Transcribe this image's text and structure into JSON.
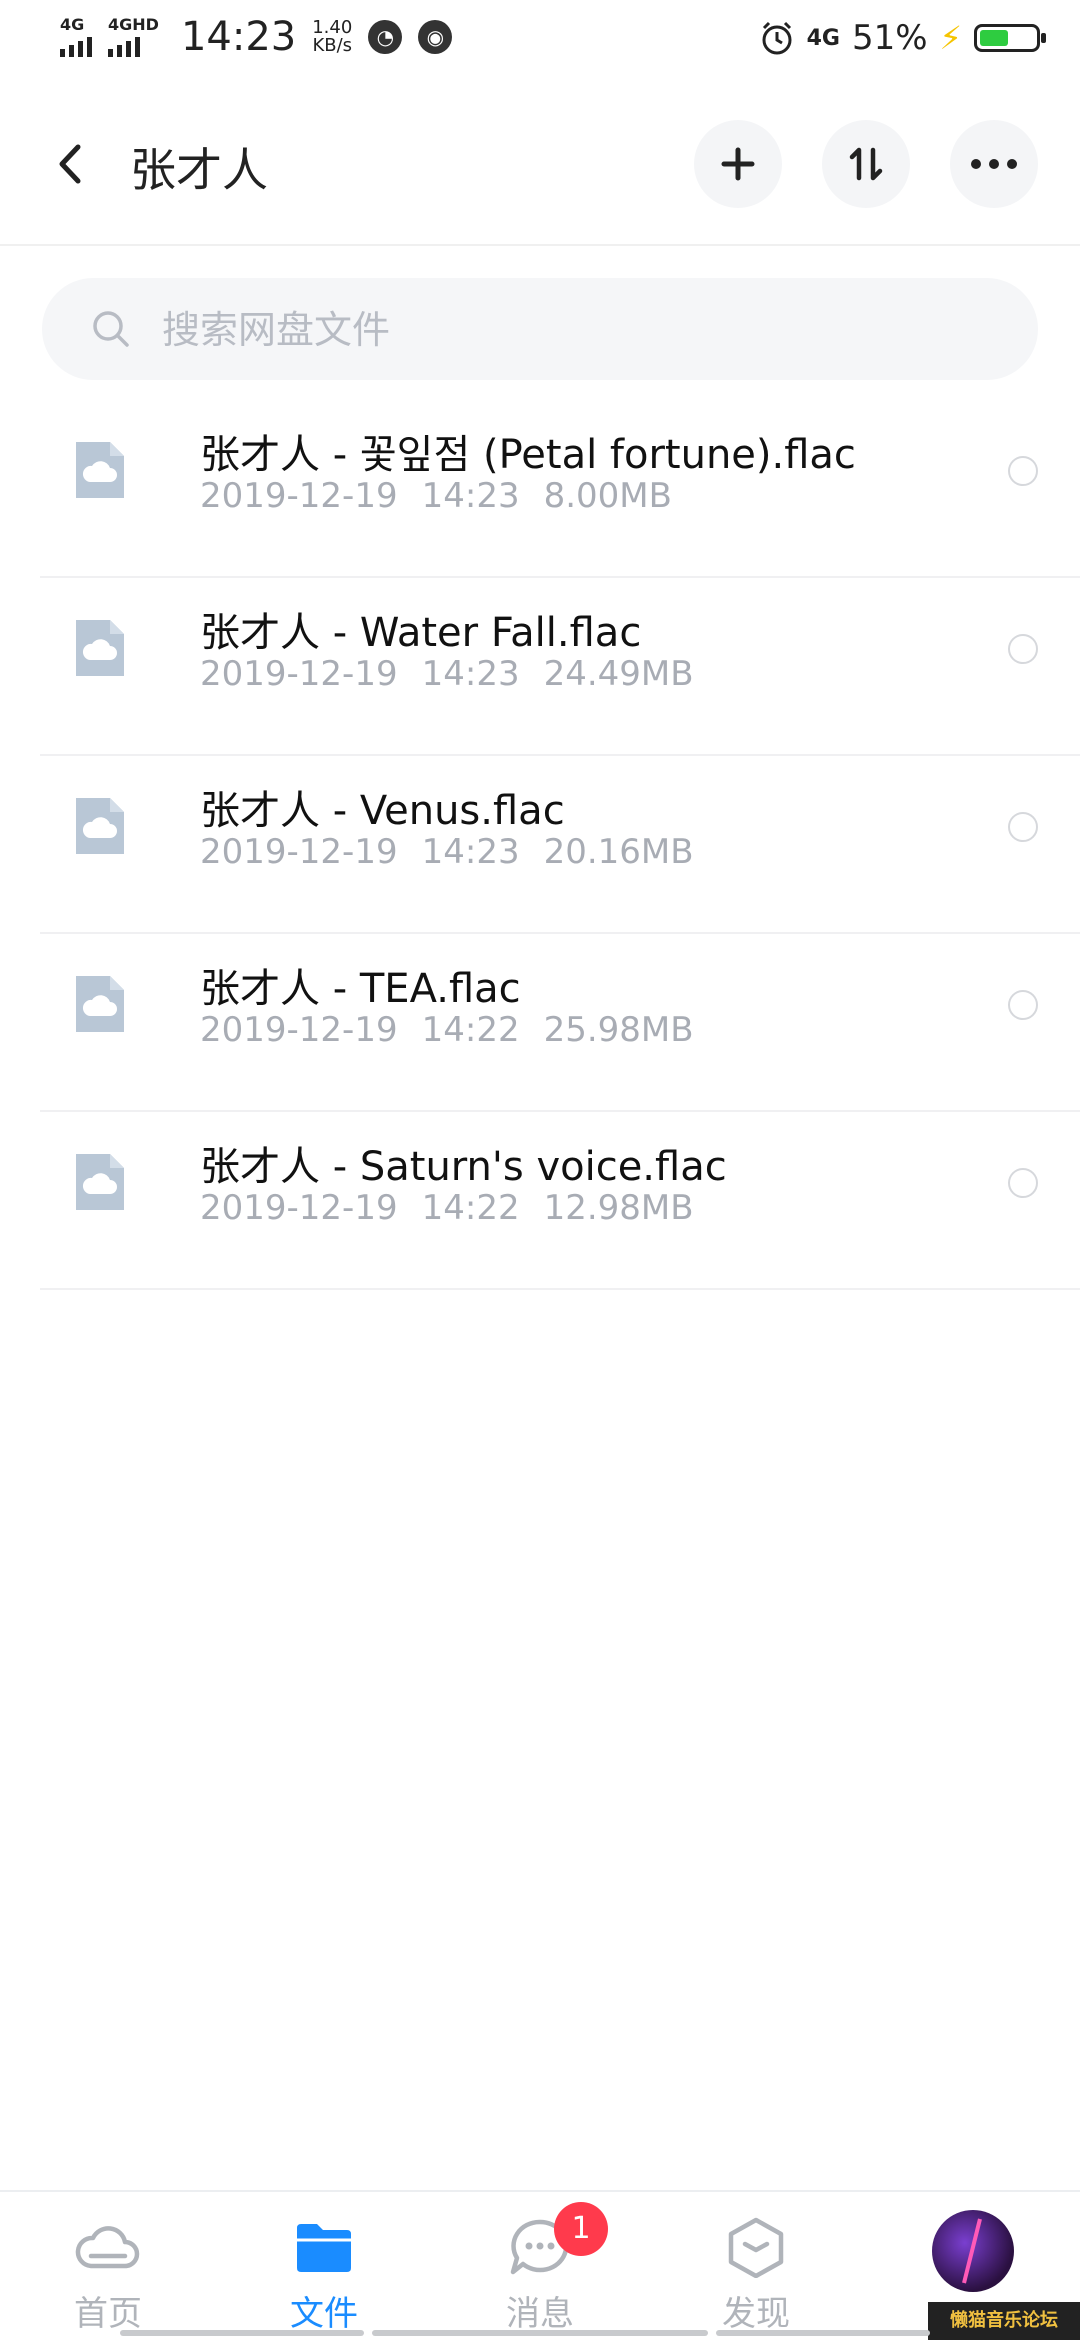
{
  "status_bar": {
    "net1": "4G",
    "net2": "4GHD",
    "time": "14:23",
    "speed_value": "1.40",
    "speed_unit": "KB/s",
    "net3": "4G",
    "battery_percent": "51%",
    "battery_level": 0.51,
    "battery_color": "#2ecc40",
    "icons": [
      "signal-icon",
      "speedometer-icon",
      "globe-icon",
      "alarm-icon",
      "charging-icon",
      "battery-icon"
    ]
  },
  "header": {
    "title": "张才人",
    "back_icon": "chevron-left-icon",
    "actions": [
      "plus-icon",
      "sort-icon",
      "more-icon"
    ]
  },
  "search": {
    "placeholder": "搜索网盘文件"
  },
  "files": [
    {
      "name": "张才人 - 꽃잎점 (Petal fortune).flac",
      "date": "2019-12-19",
      "time": "14:23",
      "size": "8.00MB"
    },
    {
      "name": "张才人 - Water Fall.flac",
      "date": "2019-12-19",
      "time": "14:23",
      "size": "24.49MB"
    },
    {
      "name": "张才人 - Venus.flac",
      "date": "2019-12-19",
      "time": "14:23",
      "size": "20.16MB"
    },
    {
      "name": "张才人 - TEA.flac",
      "date": "2019-12-19",
      "time": "14:22",
      "size": "25.98MB"
    },
    {
      "name": "张才人 - Saturn's voice.flac",
      "date": "2019-12-19",
      "time": "14:22",
      "size": "12.98MB"
    }
  ],
  "bottom_nav": {
    "home": "首页",
    "files": "文件",
    "messages": "消息",
    "messages_badge": "1",
    "discover": "发现"
  },
  "watermark": "懒猫音乐论坛",
  "colors": {
    "accent": "#1a8cff",
    "badge": "#ff3a4c",
    "file_icon": "#b9c7d6"
  }
}
